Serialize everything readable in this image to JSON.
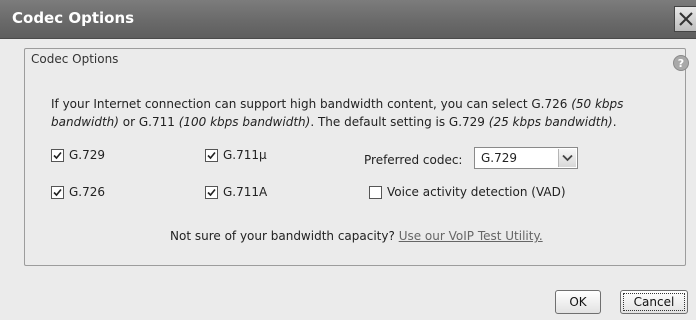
{
  "dialog": {
    "title": "Codec Options",
    "group_legend": "Codec Options",
    "description": {
      "part1": "If your Internet connection can support high bandwidth content, you can select G.726 ",
      "g726_bw": "(50 kbps bandwidth)",
      "part2": " or G.711 ",
      "g711_bw": "(100 kbps bandwidth)",
      "part3": ". The default setting is G.729 ",
      "g729_bw": "(25 kbps bandwidth)",
      "part4": "."
    },
    "codecs": [
      {
        "label": "G.729",
        "checked": true
      },
      {
        "label": "G.711μ",
        "checked": true
      },
      {
        "label": "G.726",
        "checked": true
      },
      {
        "label": "G.711A",
        "checked": true
      }
    ],
    "preferred_codec_label": "Preferred codec:",
    "preferred_codec_value": "G.729",
    "vad": {
      "label": "Voice activity detection (VAD)",
      "checked": false
    },
    "note_text": "Not sure of your bandwidth capacity?",
    "note_link": "Use our VoIP Test Utility.",
    "buttons": {
      "ok": "OK",
      "cancel": "Cancel"
    }
  }
}
